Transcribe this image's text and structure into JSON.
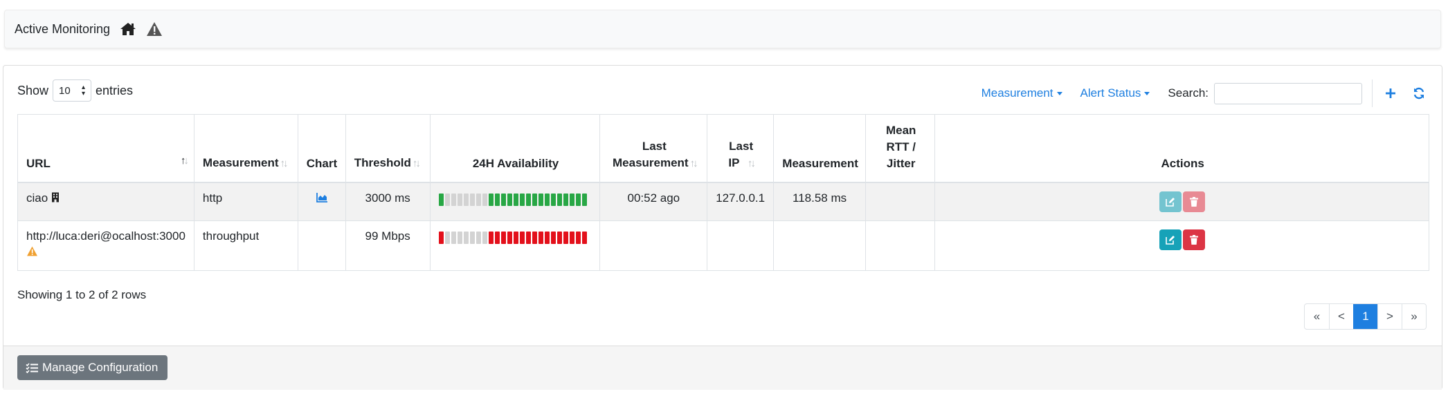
{
  "navbar": {
    "title": "Active Monitoring",
    "icons": [
      "home-icon",
      "warning-icon"
    ]
  },
  "controls": {
    "show_label": "Show",
    "entries_value": "10",
    "entries_label": "entries",
    "measurement_filter": "Measurement",
    "alert_status_filter": "Alert Status",
    "search_label": "Search:",
    "search_value": ""
  },
  "table": {
    "headers": {
      "url": "URL",
      "measurement": "Measurement",
      "chart": "Chart",
      "threshold": "Threshold",
      "availability": "24H Availability",
      "last_measurement_1": "Last",
      "last_measurement_2": "Measurement",
      "last_ip_1": "Last",
      "last_ip_2": "IP",
      "measurement_value": "Measurement",
      "rtt_1": "Mean",
      "rtt_2": "RTT /",
      "rtt_3": "Jitter",
      "actions": "Actions"
    },
    "rows": [
      {
        "url": "ciao",
        "url_icon": "building-icon",
        "measurement": "http",
        "chart_icon": "area-chart-icon",
        "threshold": "3000 ms",
        "availability": [
          "green",
          "gray",
          "gray",
          "gray",
          "gray",
          "gray",
          "gray",
          "gray",
          "green",
          "green",
          "green",
          "green",
          "green",
          "green",
          "green",
          "green",
          "green",
          "green",
          "green",
          "green",
          "green",
          "green",
          "green",
          "green"
        ],
        "last_measurement": "00:52 ago",
        "last_ip": "127.0.0.1",
        "measurement_value": "118.58 ms",
        "rtt": ""
      },
      {
        "url": "http://luca:deri@ocalhost:3000",
        "url_icon": "warning-icon",
        "measurement": "throughput",
        "chart_icon": "",
        "threshold": "99 Mbps",
        "availability": [
          "red",
          "gray",
          "gray",
          "gray",
          "gray",
          "gray",
          "gray",
          "gray",
          "red",
          "red",
          "red",
          "red",
          "red",
          "red",
          "red",
          "red",
          "red",
          "red",
          "red",
          "red",
          "red",
          "red",
          "red",
          "red"
        ],
        "last_measurement": "",
        "last_ip": "",
        "measurement_value": "",
        "rtt": ""
      }
    ]
  },
  "info_text": "Showing 1 to 2 of 2 rows",
  "pagination": {
    "first": "«",
    "prev": "<",
    "current": "1",
    "next": ">",
    "last": "»"
  },
  "footer": {
    "manage_label": "Manage Configuration"
  },
  "colors": {
    "accent": "#1e7fe0",
    "green": "#28a745",
    "red": "#e3101b",
    "gray": "#d3d3d3",
    "info": "#17a2b8",
    "danger": "#dc3545",
    "warning": "#f0a030"
  }
}
